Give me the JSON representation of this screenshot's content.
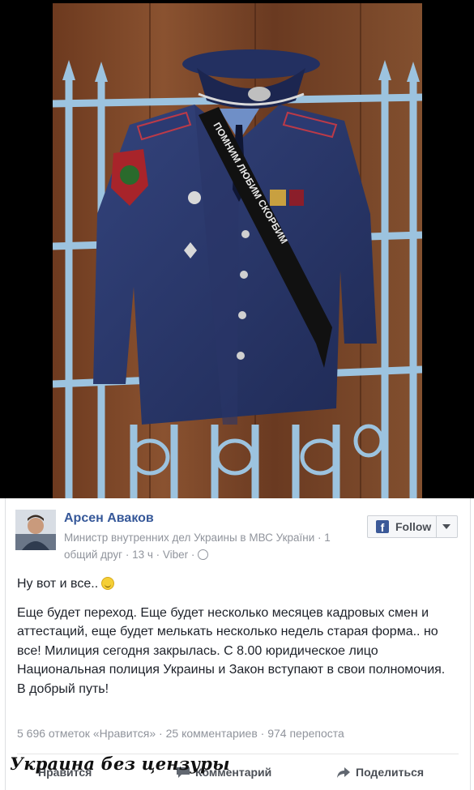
{
  "post": {
    "author": "Арсен Аваков",
    "subtitle": "Министр внутренних дел Украины в МВС України · 1 общий друг · 13 ч · Viber ·",
    "follow_label": "Follow",
    "greeting": "Ну вот и все..",
    "body": "Еще будет переход. Еще будет несколько месяцев кадровых смен и аттестаций, еще будет мелькать несколько недель старая форма.. но все! Милиция сегодня закрылась. С 8.00 юридическое лицо Национальная полиция Украины и Закон вступают в свои полномочия.",
    "closing": "В добрый путь!",
    "stats": "5 696 отметок «Нравится» · 25 комментариев · 974 перепоста",
    "actions": {
      "like": "Нравится",
      "comment": "Комментарий",
      "share": "Поделиться"
    }
  },
  "photo": {
    "sash_text": "ПОМНИМ ЛЮБИМ СКОРБИМ"
  },
  "watermark": "Украина без цензуры",
  "colors": {
    "link_blue": "#365899",
    "uniform_blue": "#2d3d73",
    "railing_blue": "#8fb8d6",
    "wood": "#7a4526"
  }
}
